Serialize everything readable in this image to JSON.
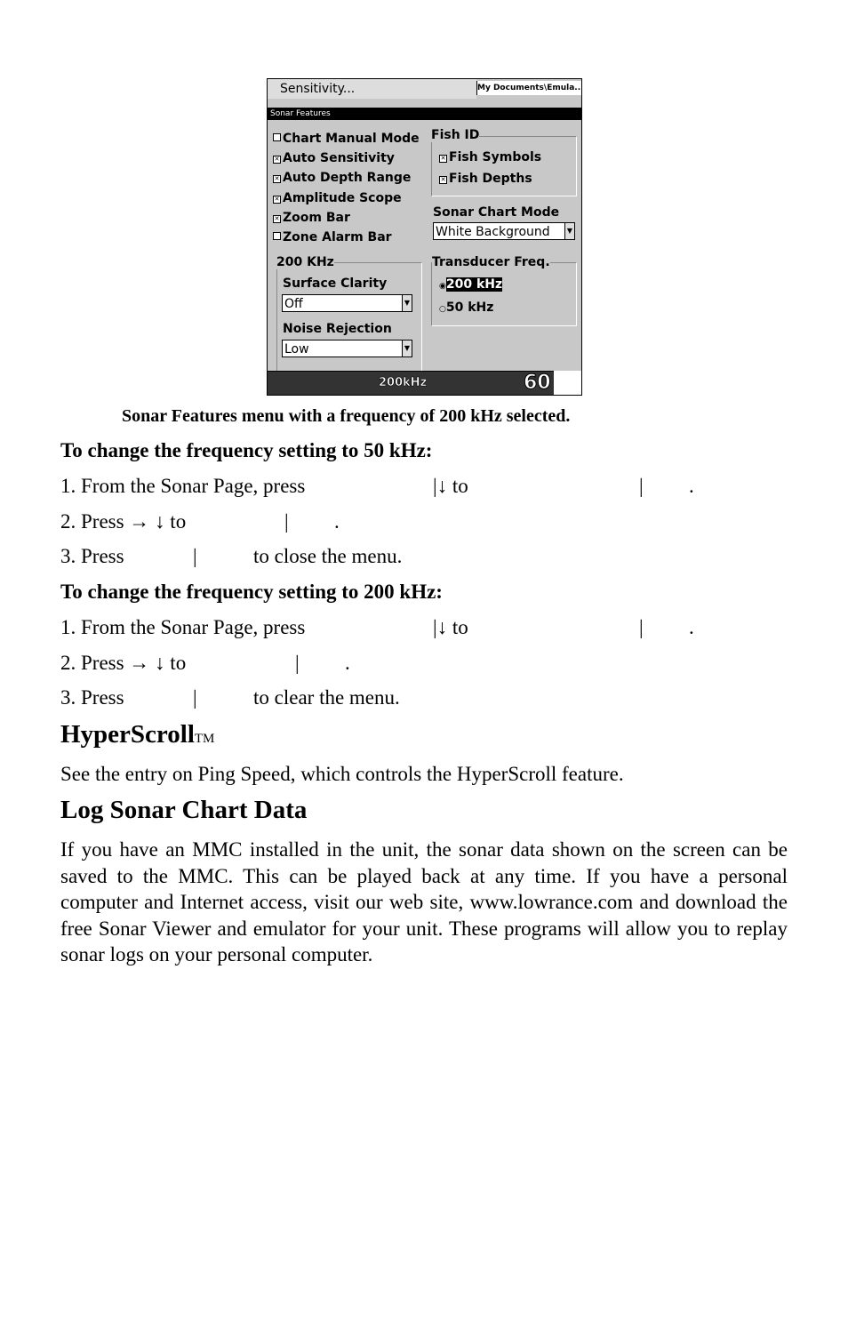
{
  "screenshot": {
    "top_menu_item": "Sensitivity...",
    "top_menu_item2": "Auto Sensitivity",
    "path_text": "My Documents\\Emula...",
    "title": "Sonar Features",
    "checkboxes": [
      {
        "label": "Chart Manual Mode",
        "checked": false
      },
      {
        "label": "Auto Sensitivity",
        "checked": true
      },
      {
        "label": "Auto Depth Range",
        "checked": true
      },
      {
        "label": "Amplitude Scope",
        "checked": true
      },
      {
        "label": "Zoom Bar",
        "checked": true
      },
      {
        "label": "Zone Alarm Bar",
        "checked": false
      }
    ],
    "fish_id": {
      "label": "Fish ID",
      "items": [
        {
          "label": "Fish Symbols",
          "checked": true
        },
        {
          "label": "Fish Depths",
          "checked": true
        }
      ]
    },
    "sonar_chart_mode": {
      "label": "Sonar Chart Mode",
      "value": "White Background"
    },
    "group_200": {
      "label": "200 KHz",
      "surface_clarity_label": "Surface Clarity",
      "surface_clarity_value": "Off",
      "noise_rejection_label": "Noise Rejection",
      "noise_rejection_value": "Low"
    },
    "transducer": {
      "label": "Transducer Freq.",
      "options": [
        {
          "label": "200 kHz",
          "selected": true
        },
        {
          "label": "50 kHz",
          "selected": false
        }
      ]
    },
    "status_freq": "200kHz",
    "status_depth": "60"
  },
  "caption": "Sonar Features menu with a frequency of 200 kHz selected.",
  "section1": {
    "heading": "To change the frequency setting to 50 kHz:",
    "s1a": "1. From the Sonar Page, press",
    "s1b": "|↓ to",
    "s1c": "|",
    "s1d": ".",
    "s2a": "2. Press → ↓ to",
    "s2b": "|",
    "s2c": ".",
    "s3a": "3. Press",
    "s3b": "|",
    "s3c": "to close the menu."
  },
  "section2": {
    "heading": "To change the frequency setting to 200 kHz:",
    "s1a": "1. From the Sonar Page, press",
    "s1b": "|↓ to",
    "s1c": "|",
    "s1d": ".",
    "s2a": "2. Press → ↓ to",
    "s2b": "|",
    "s2c": ".",
    "s3a": "3. Press",
    "s3b": "|",
    "s3c": "to clear the menu."
  },
  "hyperscroll": {
    "heading": "HyperScroll",
    "tm": "TM",
    "text": "See the entry on Ping Speed, which controls the HyperScroll feature."
  },
  "log": {
    "heading": "Log Sonar Chart Data",
    "text": "If you have an MMC installed in the unit, the sonar data shown on the screen can be saved to the MMC. This can be played back at any time. If you have a personal computer and Internet access, visit our web site, www.lowrance.com and download the free Sonar Viewer and emulator for your unit. These programs will allow you to replay sonar logs on your personal computer."
  }
}
